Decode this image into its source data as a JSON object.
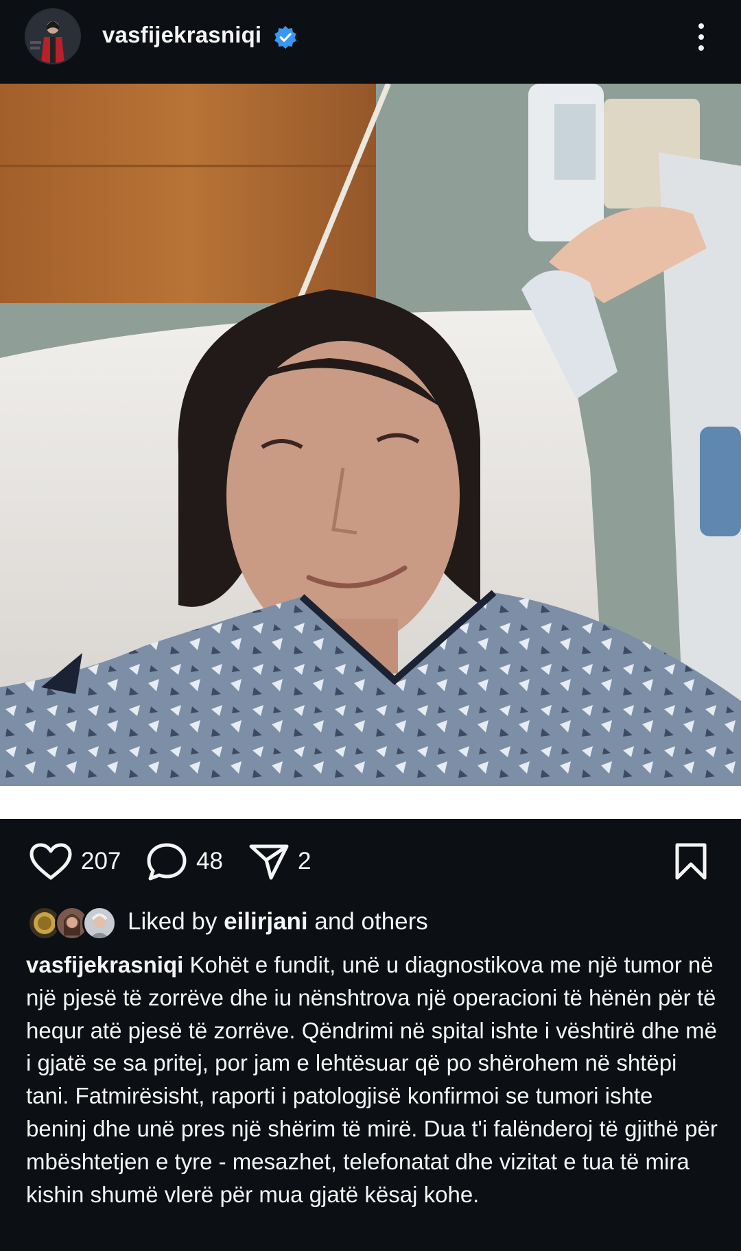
{
  "header": {
    "username": "vasfijekrasniqi",
    "verified": true,
    "avatar_icon": "profile-avatar",
    "more_icon": "more-vertical-icon"
  },
  "post": {
    "image_description_icon": "post-photo"
  },
  "actions": {
    "likes_count": "207",
    "comments_count": "48",
    "shares_count": "2",
    "like_icon": "heart-icon",
    "comment_icon": "comment-icon",
    "share_icon": "send-icon",
    "save_icon": "bookmark-icon"
  },
  "likes": {
    "prefix": "Liked by ",
    "user": "eilirjani",
    "suffix": " and others"
  },
  "caption": {
    "username": "vasfijekrasniqi",
    "text": "Kohët e fundit, unë u diagnostikova me një tumor në një pjesë të zorrëve dhe iu nënshtrova një operacioni të hënën për të hequr atë pjesë të zorrëve. Qëndrimi në spital ishte i vështirë dhe më i gjatë se sa pritej, por jam e lehtësuar që po shërohem në shtëpi tani. Fatmirësisht, raporti i patologjisë konfirmoi se tumori ishte beninj dhe unë pres një shërim të mirë. Dua t'i falënderoj të gjithë për mbështetjen e tyre - mesazhet, telefonatat dhe vizitat e tua të mira kishin shumë vlerë për mua gjatë kësaj kohe."
  },
  "colors": {
    "background": "#0c1014",
    "text": "#f5f5f5",
    "verified_blue": "#3897f0"
  }
}
